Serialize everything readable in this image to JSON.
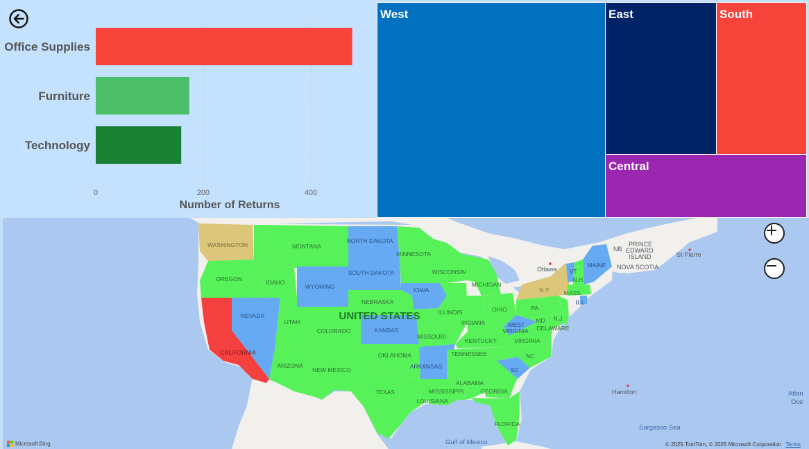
{
  "bar_chart": {
    "xlabel": "Number of Returns",
    "colors": [
      "#f6443a",
      "#4cbf68",
      "#1a8034"
    ]
  },
  "chart_data": {
    "type": "bar",
    "orientation": "horizontal",
    "categories": [
      "Office Supplies",
      "Furniture",
      "Technology"
    ],
    "values": [
      477,
      174,
      159
    ],
    "xlabel": "Number of Returns",
    "ylabel": "",
    "xlim": [
      0,
      480
    ],
    "xticks": [
      0,
      200,
      400
    ],
    "grid": true
  },
  "treemap": {
    "cells": [
      {
        "label": "West",
        "color": "#0070bf"
      },
      {
        "label": "East",
        "color": "#002266"
      },
      {
        "label": "South",
        "color": "#f6443a"
      },
      {
        "label": "Central",
        "color": "#9b27b0"
      }
    ]
  },
  "map": {
    "country_label": "UNITED STATES",
    "colors": {
      "green": "#57f25a",
      "blue": "#65aaf2",
      "red": "#f4403f",
      "tan": "#dcc679"
    },
    "states": {
      "washington": "WASHINGTON",
      "oregon": "OREGON",
      "california": "CALIFORNIA",
      "nevada": "NEVADA",
      "idaho": "IDAHO",
      "montana": "MONTANA",
      "wyoming": "WYOMING",
      "utah": "UTAH",
      "arizona": "ARIZONA",
      "colorado": "COLORADO",
      "new_mexico": "NEW MEXICO",
      "north_dakota": "NORTH DAKOTA",
      "south_dakota": "SOUTH DAKOTA",
      "nebraska": "NEBRASKA",
      "kansas": "KANSAS",
      "oklahoma": "OKLAHOMA",
      "texas": "TEXAS",
      "minnesota": "MINNESOTA",
      "iowa": "IOWA",
      "missouri": "MISSOURI",
      "arkansas": "ARKANSAS",
      "louisiana": "LOUISIANA",
      "wisconsin": "WISCONSIN",
      "illinois": "ILLINOIS",
      "michigan": "MICHIGAN",
      "indiana": "INDIANA",
      "ohio": "OHIO",
      "kentucky": "KENTUCKY",
      "tennessee": "TENNESSEE",
      "mississippi": "MISSISSIPPI",
      "alabama": "ALABAMA",
      "georgia": "GEORGIA",
      "florida": "FLORIDA",
      "south_carolina": "SC",
      "north_carolina": "NC",
      "virginia": "VIRGINIA",
      "west_virginia_1": "WEST",
      "west_virginia_2": "VIRGINIA",
      "pennsylvania": "PA",
      "new_york": "N.Y.",
      "maryland": "MD",
      "delaware": "DELAWARE",
      "new_jersey": "N.J.",
      "vermont": "VT",
      "new_hampshire": "N.H.",
      "massachusetts": "MASS.",
      "rhode_island": "R.I.",
      "maine": "MAINE"
    },
    "places": {
      "ottawa": "Ottawa",
      "nb": "NB",
      "pei_1": "PRINCE",
      "pei_2": "EDWARD",
      "pei_3": "ISLAND",
      "nova_scotia": "NOVA SCOTIA",
      "st_pierre": "St-Pierre",
      "hamilton": "Hamilton",
      "sargasso": "Sargasso Sea",
      "gulf_of_mexico": "Gulf of Mexico",
      "atlantic_1": "Atlan",
      "atlantic_2": "Oce"
    },
    "bing_label": "Microsoft Bing",
    "attribution": "© 2025 TomTom, © 2025 Microsoft Corporation",
    "terms_link": "Terms"
  }
}
